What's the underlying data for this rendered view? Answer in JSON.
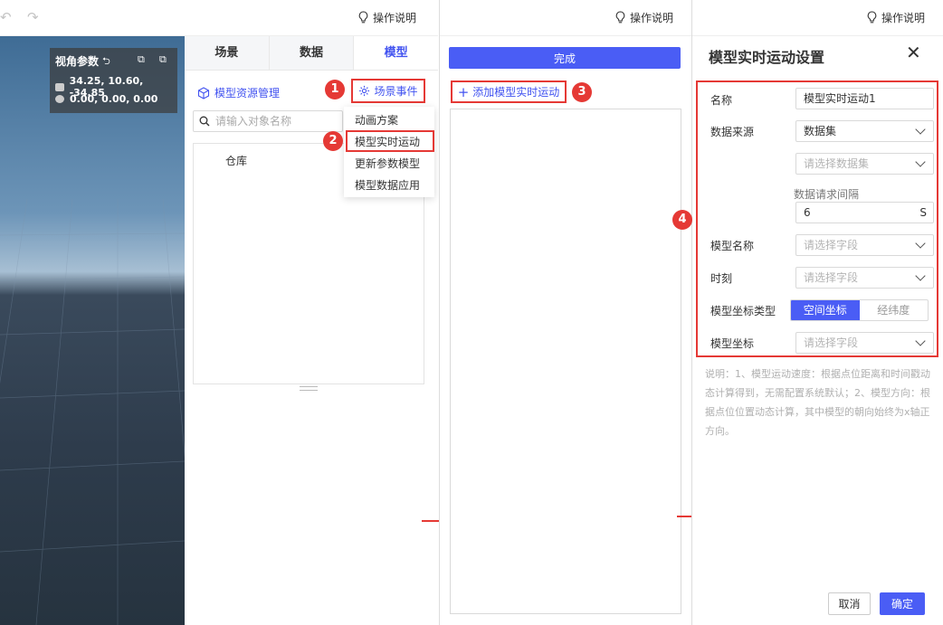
{
  "help_label": "操作说明",
  "toolbar": {
    "undo_icon": "undo-arrow",
    "redo_icon": "redo-arrow"
  },
  "view_params": {
    "title": "视角参数",
    "camera_position": "34.25, 10.60, -34.85",
    "target_position": "0.00, 0.00, 0.00"
  },
  "sidebar": {
    "tabs": [
      "场景",
      "数据",
      "模型"
    ],
    "active_tab": "模型",
    "resource_manager": "模型资源管理",
    "scene_event": "场景事件",
    "search_placeholder": "请输入对象名称",
    "tree_nodes": [
      "仓库"
    ]
  },
  "dropdown": {
    "items": [
      "动画方案",
      "模型实时运动",
      "更新参数模型",
      "模型数据应用"
    ],
    "highlighted": "模型实时运动"
  },
  "steps": [
    "1",
    "2",
    "3",
    "4"
  ],
  "motion_panel": {
    "done_label": "完成",
    "add_label": "添加模型实时运动"
  },
  "settings": {
    "title": "模型实时运动设置",
    "fields": {
      "name_label": "名称",
      "name_value": "模型实时运动1",
      "source_label": "数据来源",
      "source_value": "数据集",
      "dataset_placeholder": "请选择数据集",
      "interval_label": "数据请求间隔",
      "interval_value": "6",
      "interval_unit": "S",
      "model_name_label": "模型名称",
      "field_placeholder": "请选择字段",
      "time_label": "时刻",
      "coord_type_label": "模型坐标类型",
      "coord_type_options": [
        "空间坐标",
        "经纬度"
      ],
      "coord_type_selected": "空间坐标",
      "coord_label": "模型坐标"
    },
    "note": "说明：1、模型运动速度：根据点位距离和时间戳动态计算得到，无需配置系统默认；2、模型方向：根据点位位置动态计算，其中模型的朝向始终为x轴正方向。",
    "cancel_label": "取消",
    "ok_label": "确定"
  },
  "colors": {
    "accent": "#4a5df5",
    "highlight": "#e53935"
  }
}
